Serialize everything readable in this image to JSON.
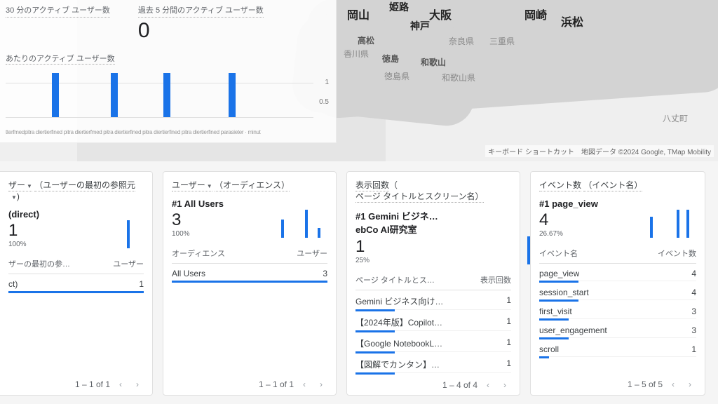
{
  "overlay": {
    "leftTitle": "30 分のアクティブ ユーザー数",
    "rightTitle": "過去 5 分間のアクティブ ユーザー数",
    "rightValue": "0",
    "subTitle": "あたりのアクティブ ユーザー数",
    "yTick1": "1",
    "yTick2": "0.5",
    "xAxis": "tterfmedpitra diertierfined pitra diertierfmed pitra diertierfined pitra diertierfined pitra diertierfined parasieter · minut"
  },
  "map": {
    "labels": {
      "okayama": "岡山",
      "himeji": "姫路",
      "osaka": "大阪",
      "kobe": "神戸",
      "okazaki": "岡崎",
      "hamamatsu": "浜松",
      "takamatsu": "高松",
      "naraken": "奈良県",
      "mieken": "三重県",
      "kagawaken": "香川県",
      "tokushima": "徳島",
      "wakayama": "和歌山",
      "tokushimaken": "徳島県",
      "wakayamaken": "和歌山県",
      "hachijo": "八丈町"
    },
    "attr1": "キーボード ショートカット",
    "attr2": "地図データ ©2024 Google, TMap Mobility"
  },
  "cards": {
    "c1": {
      "title_a": "ザー",
      "title_b": "（ユーザーの最初の参照元",
      "rankLabel": "(direct)",
      "rankValue": "1",
      "rankPct": "100%",
      "thK": "ザーの最初の参…",
      "thV": "ユーザー",
      "r1k": "ct)",
      "r1v": "1",
      "pager": "1 – 1 of 1"
    },
    "c2": {
      "title_a": "ユーザー",
      "title_b": "（オーディエンス）",
      "rankPrefix": "#1 ",
      "rankLabel": "All Users",
      "rankValue": "3",
      "rankPct": "100%",
      "thK": "オーディエンス",
      "thV": "ユーザー",
      "r1k": "All Users",
      "r1v": "3",
      "pager": "1 – 1 of 1"
    },
    "c3": {
      "title_a": "表示回数",
      "title_b": "（",
      "title_c": "ページ タイトルとスクリーン名）",
      "rankPrefix": "#1 ",
      "rankLabel": "Gemini ビジネ…ebCo AI研究室",
      "rankValue": "1",
      "rankPct": "25%",
      "thK": "ページ タイトルとス…",
      "thV": "表示回数",
      "rows": [
        {
          "k": "Gemini ビジネス向け…",
          "v": "1",
          "w": 100
        },
        {
          "k": "【2024年版】Copilot…",
          "v": "1",
          "w": 100
        },
        {
          "k": "【Google NotebookL…",
          "v": "1",
          "w": 100
        },
        {
          "k": "【図解でカンタン】…",
          "v": "1",
          "w": 100
        }
      ],
      "pager": "1 – 4 of 4"
    },
    "c4": {
      "title_a": "イベント数",
      "title_b": "（イベント名）",
      "rankPrefix": "#1 ",
      "rankLabel": "page_view",
      "rankValue": "4",
      "rankPct": "26.67%",
      "thK": "イベント名",
      "thV": "イベント数",
      "rows": [
        {
          "k": "page_view",
          "v": "4",
          "w": 100
        },
        {
          "k": "session_start",
          "v": "4",
          "w": 100
        },
        {
          "k": "first_visit",
          "v": "3",
          "w": 75
        },
        {
          "k": "user_engagement",
          "v": "3",
          "w": 75
        },
        {
          "k": "scroll",
          "v": "1",
          "w": 25
        }
      ],
      "pager": "1 – 5 of 5"
    }
  },
  "chart_data": [
    {
      "type": "bar",
      "title": "あたりのアクティブ ユーザー数",
      "ylabel": "",
      "ylim": [
        0,
        1
      ],
      "categories": [
        "-30m",
        "-29m",
        "-28m",
        "-27m",
        "-26m",
        "-25m",
        "-24m",
        "-23m",
        "-22m",
        "-21m",
        "-20m",
        "-19m",
        "-18m",
        "-17m",
        "-16m",
        "-15m",
        "-14m",
        "-13m",
        "-12m",
        "-11m",
        "-10m",
        "-9m",
        "-8m",
        "-7m",
        "-6m",
        "-5m",
        "-4m",
        "-3m",
        "-2m",
        "-1m"
      ],
      "values": [
        0,
        0,
        0,
        0,
        1,
        0,
        0,
        0,
        0,
        0,
        1,
        0,
        0,
        0,
        0,
        1,
        0,
        0,
        0,
        0,
        0,
        1,
        0,
        0,
        0,
        0,
        0,
        0,
        0,
        0
      ]
    },
    {
      "type": "bar",
      "title": "(direct) — 最初の参照元",
      "categories": [
        "bin1",
        "bin2",
        "bin3",
        "bin4",
        "bin5",
        "bin6",
        "bin7"
      ],
      "values": [
        0,
        0,
        0,
        0,
        0,
        0,
        1
      ]
    },
    {
      "type": "bar",
      "title": "All Users — オーディエンス",
      "categories": [
        "bin1",
        "bin2",
        "bin3",
        "bin4",
        "bin5",
        "bin6",
        "bin7"
      ],
      "values": [
        0,
        0,
        0,
        2,
        0,
        3,
        1
      ]
    },
    {
      "type": "bar",
      "title": "Gemini ビジネ…ebCo AI研究室 — 表示回数",
      "categories": [
        "bin1",
        "bin2",
        "bin3",
        "bin4",
        "bin5",
        "bin6",
        "bin7"
      ],
      "values": [
        0,
        0,
        0,
        0,
        0,
        0,
        1
      ]
    },
    {
      "type": "bar",
      "title": "page_view — イベント数",
      "categories": [
        "bin1",
        "bin2",
        "bin3",
        "bin4",
        "bin5",
        "bin6",
        "bin7"
      ],
      "values": [
        0,
        0,
        0,
        3,
        0,
        4,
        4
      ]
    }
  ]
}
